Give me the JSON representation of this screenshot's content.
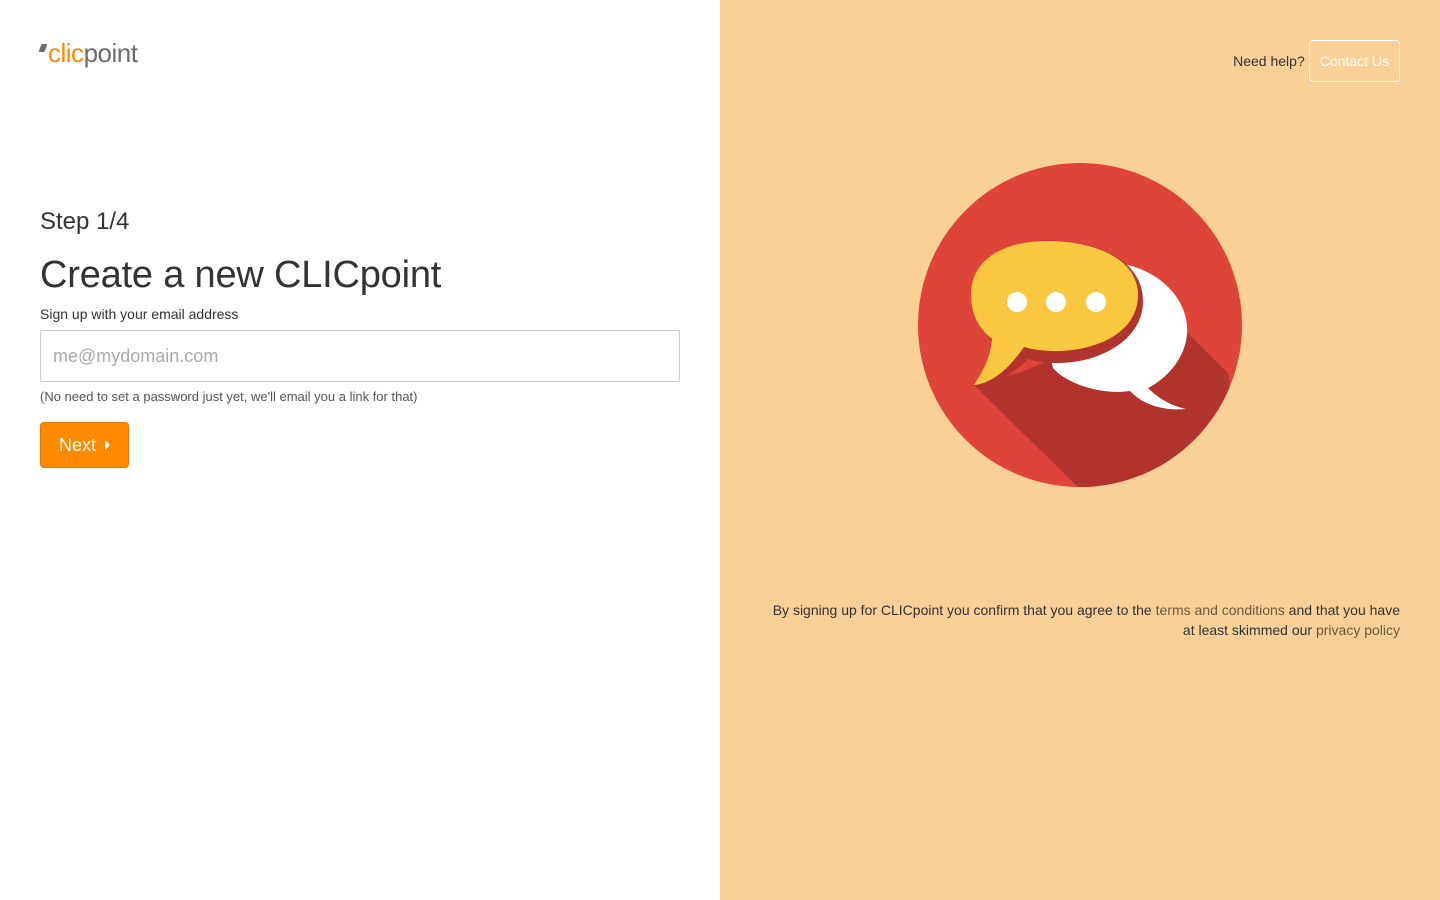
{
  "logo": {
    "part1": "clic",
    "part2": "point"
  },
  "form": {
    "step": "Step 1/4",
    "title": "Create a new CLICpoint",
    "email_label": "Sign up with your email address",
    "email_placeholder": "me@mydomain.com",
    "email_value": "",
    "hint": "(No need to set a password just yet, we'll email you a link for that)",
    "next_label": "Next"
  },
  "help": {
    "text": "Need help?",
    "contact_label": "Contact Us"
  },
  "legal": {
    "prefix": "By signing up for CLICpoint you confirm that you agree to the ",
    "terms_link": "terms and conditions",
    "middle": " and that you have at least skimmed our ",
    "privacy_link": "privacy policy"
  },
  "colors": {
    "accent": "#ff8a00",
    "panel": "#fad096",
    "circle": "#df4438",
    "bubble_yellow": "#f9c83f"
  },
  "icons": {
    "illustration": "chat-bubbles-icon",
    "next_caret": "caret-right-icon"
  }
}
